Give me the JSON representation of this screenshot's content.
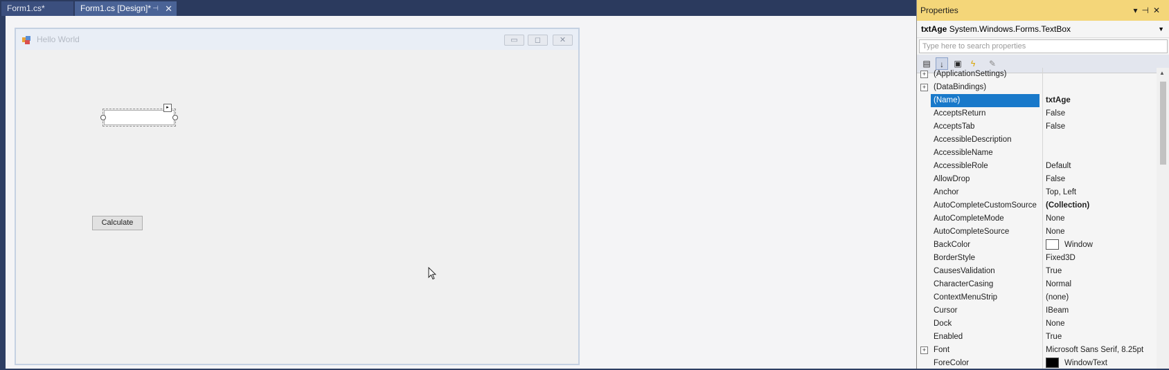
{
  "tabs": [
    {
      "label": "Form1.cs*"
    },
    {
      "label": "Form1.cs [Design]*"
    }
  ],
  "form": {
    "title": "Hello World",
    "calculate_button": "Calculate"
  },
  "properties": {
    "title": "Properties",
    "object_name": "txtAge",
    "object_type": "System.Windows.Forms.TextBox",
    "search_placeholder": "Type here to search properties",
    "rows": [
      {
        "name": "(ApplicationSettings)",
        "value": "",
        "expandable": true
      },
      {
        "name": "(DataBindings)",
        "value": "",
        "expandable": true
      },
      {
        "name": "(Name)",
        "value": "txtAge",
        "selected": true
      },
      {
        "name": "AcceptsReturn",
        "value": "False"
      },
      {
        "name": "AcceptsTab",
        "value": "False"
      },
      {
        "name": "AccessibleDescription",
        "value": ""
      },
      {
        "name": "AccessibleName",
        "value": ""
      },
      {
        "name": "AccessibleRole",
        "value": "Default"
      },
      {
        "name": "AllowDrop",
        "value": "False"
      },
      {
        "name": "Anchor",
        "value": "Top, Left"
      },
      {
        "name": "AutoCompleteCustomSource",
        "value": "(Collection)",
        "bold": true
      },
      {
        "name": "AutoCompleteMode",
        "value": "None"
      },
      {
        "name": "AutoCompleteSource",
        "value": "None"
      },
      {
        "name": "BackColor",
        "value": "Window",
        "swatch": "#ffffff"
      },
      {
        "name": "BorderStyle",
        "value": "Fixed3D"
      },
      {
        "name": "CausesValidation",
        "value": "True"
      },
      {
        "name": "CharacterCasing",
        "value": "Normal"
      },
      {
        "name": "ContextMenuStrip",
        "value": "(none)"
      },
      {
        "name": "Cursor",
        "value": "IBeam"
      },
      {
        "name": "Dock",
        "value": "None"
      },
      {
        "name": "Enabled",
        "value": "True"
      },
      {
        "name": "Font",
        "value": "Microsoft Sans Serif, 8.25pt",
        "expandable": true
      },
      {
        "name": "ForeColor",
        "value": "WindowText",
        "swatch": "#000000"
      }
    ]
  },
  "colors": {
    "tab_active": "#4a6396",
    "properties_title": "#f4d679",
    "selection": "#1979ca"
  }
}
